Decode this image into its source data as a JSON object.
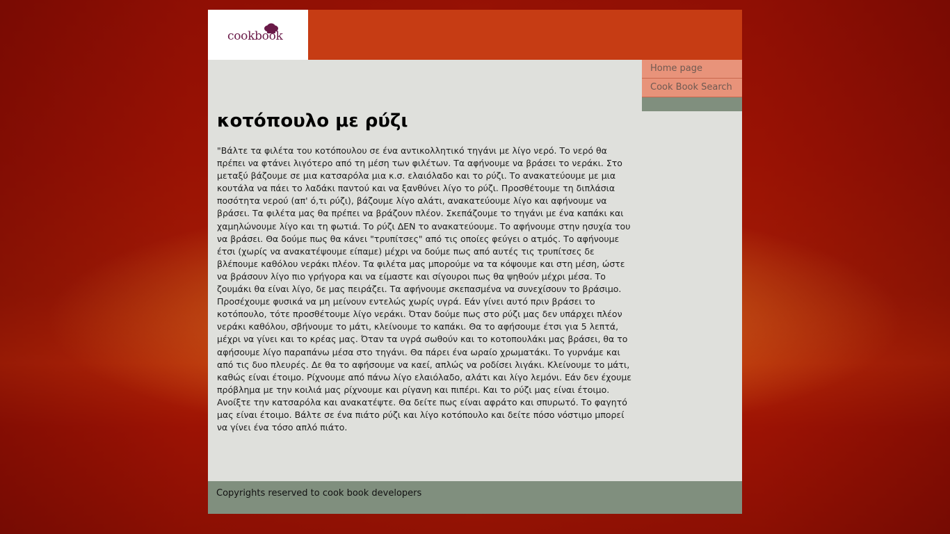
{
  "header": {
    "logo_text": "cookbook"
  },
  "nav": {
    "items": [
      {
        "label": "Home page"
      },
      {
        "label": "Cook Book Search"
      }
    ]
  },
  "main": {
    "title": "κοτόπουλο με ρύζι",
    "body": "\"Βάλτε τα φιλέτα του κοτόπουλου σε ένα αντικολλητικό τηγάνι με λίγο νερό. Το νερό θα πρέπει να φτάνει λιγότερο από τη μέση των φιλέτων. Τα αφήνουμε να βράσει το νεράκι. Στο μεταξύ βάζουμε σε μια κατσαρόλα μια κ.σ. ελαιόλαδο και το ρύζι. Το ανακατεύουμε με μια κουτάλα να πάει το λαδάκι παντού και να ξανθύνει λίγο το ρύζι. Προσθέτουμε τη διπλάσια ποσότητα νερού (απ' ό,τι ρύζι), βάζουμε λίγο αλάτι, ανακατεύουμε λίγο και αφήνουμε να βράσει. Τα φιλέτα μας θα πρέπει να βράζουν πλέον. Σκεπάζουμε το τηγάνι με ένα καπάκι και χαμηλώνουμε λίγο και τη φωτιά. Το ρύζι ΔΕΝ το ανακατεύουμε. Το αφήνουμε στην ησυχία του να βράσει. Θα δούμε πως θα κάνει \"τρυπίτσες\" από τις οποίες φεύγει ο ατμός. Το αφήνουμε έτσι (χωρίς να ανακατέψουμε είπαμε) μέχρι να δούμε πως από αυτές τις τρυπίτσες δε βλέπουμε καθόλου νεράκι πλέον. Τα φιλέτα μας μπορούμε να τα κόψουμε και στη μέση, ώστε να βράσουν λίγο πιο γρήγορα και να είμαστε και σίγουροι πως θα ψηθούν μέχρι μέσα. Το ζουμάκι θα είναι λίγο, δε μας πειράζει. Τα αφήνουμε σκεπασμένα να συνεχίσουν το βράσιμο. Προσέχουμε φυσικά να μη μείνουν εντελώς χωρίς υγρά. Εάν γίνει αυτό πριν βράσει το κοτόπουλο, τότε προσθέτουμε λίγο νεράκι. Όταν δούμε πως στο ρύζι μας δεν υπάρχει πλέον νεράκι καθόλου, σβήνουμε το μάτι, κλείνουμε το καπάκι. Θα το αφήσουμε έτσι για 5 λεπτά, μέχρι να γίνει και το κρέας μας. Όταν τα υγρά σωθούν και το κοτοπουλάκι μας βράσει, θα το αφήσουμε λίγο παραπάνω μέσα στο τηγάνι. Θα πάρει ένα ωραίο χρωματάκι. Το γυρνάμε και από τις δυο πλευρές. Δε θα το αφήσουμε να καεί, απλώς να ροδίσει λιγάκι. Κλείνουμε το μάτι, καθώς είναι έτοιμο. Ρίχνουμε από πάνω λίγο ελαιόλαδο, αλάτι και λίγο λεμόνι. Εάν δεν έχουμε πρόβλημα με την κοιλιά μας ρίχνουμε και ρίγανη και πιπέρι. Και το ρύζι μας είναι έτοιμο. Ανοίξτε την κατσαρόλα και ανακατέψτε. Θα δείτε πως είναι αφράτο και σπυρωτό. Το φαγητό μας είναι έτοιμο. Βάλτε σε ένα πιάτο ρύζι και λίγο κοτόπουλο και δείτε πόσο νόστιμο μπορεί να γίνει ένα τόσο απλό πιάτο."
  },
  "footer": {
    "text": "Copyrights reserved to cook book developers"
  },
  "colors": {
    "header_bg": "#c63c14",
    "nav_item_bg": "#e8937a",
    "nav_spacer_bg": "#808f7e",
    "content_bg": "#dfe0dc",
    "footer_bg": "#808f7e",
    "logo_color": "#6a1a48"
  },
  "icons": {
    "logo": "chef-hat-icon"
  }
}
